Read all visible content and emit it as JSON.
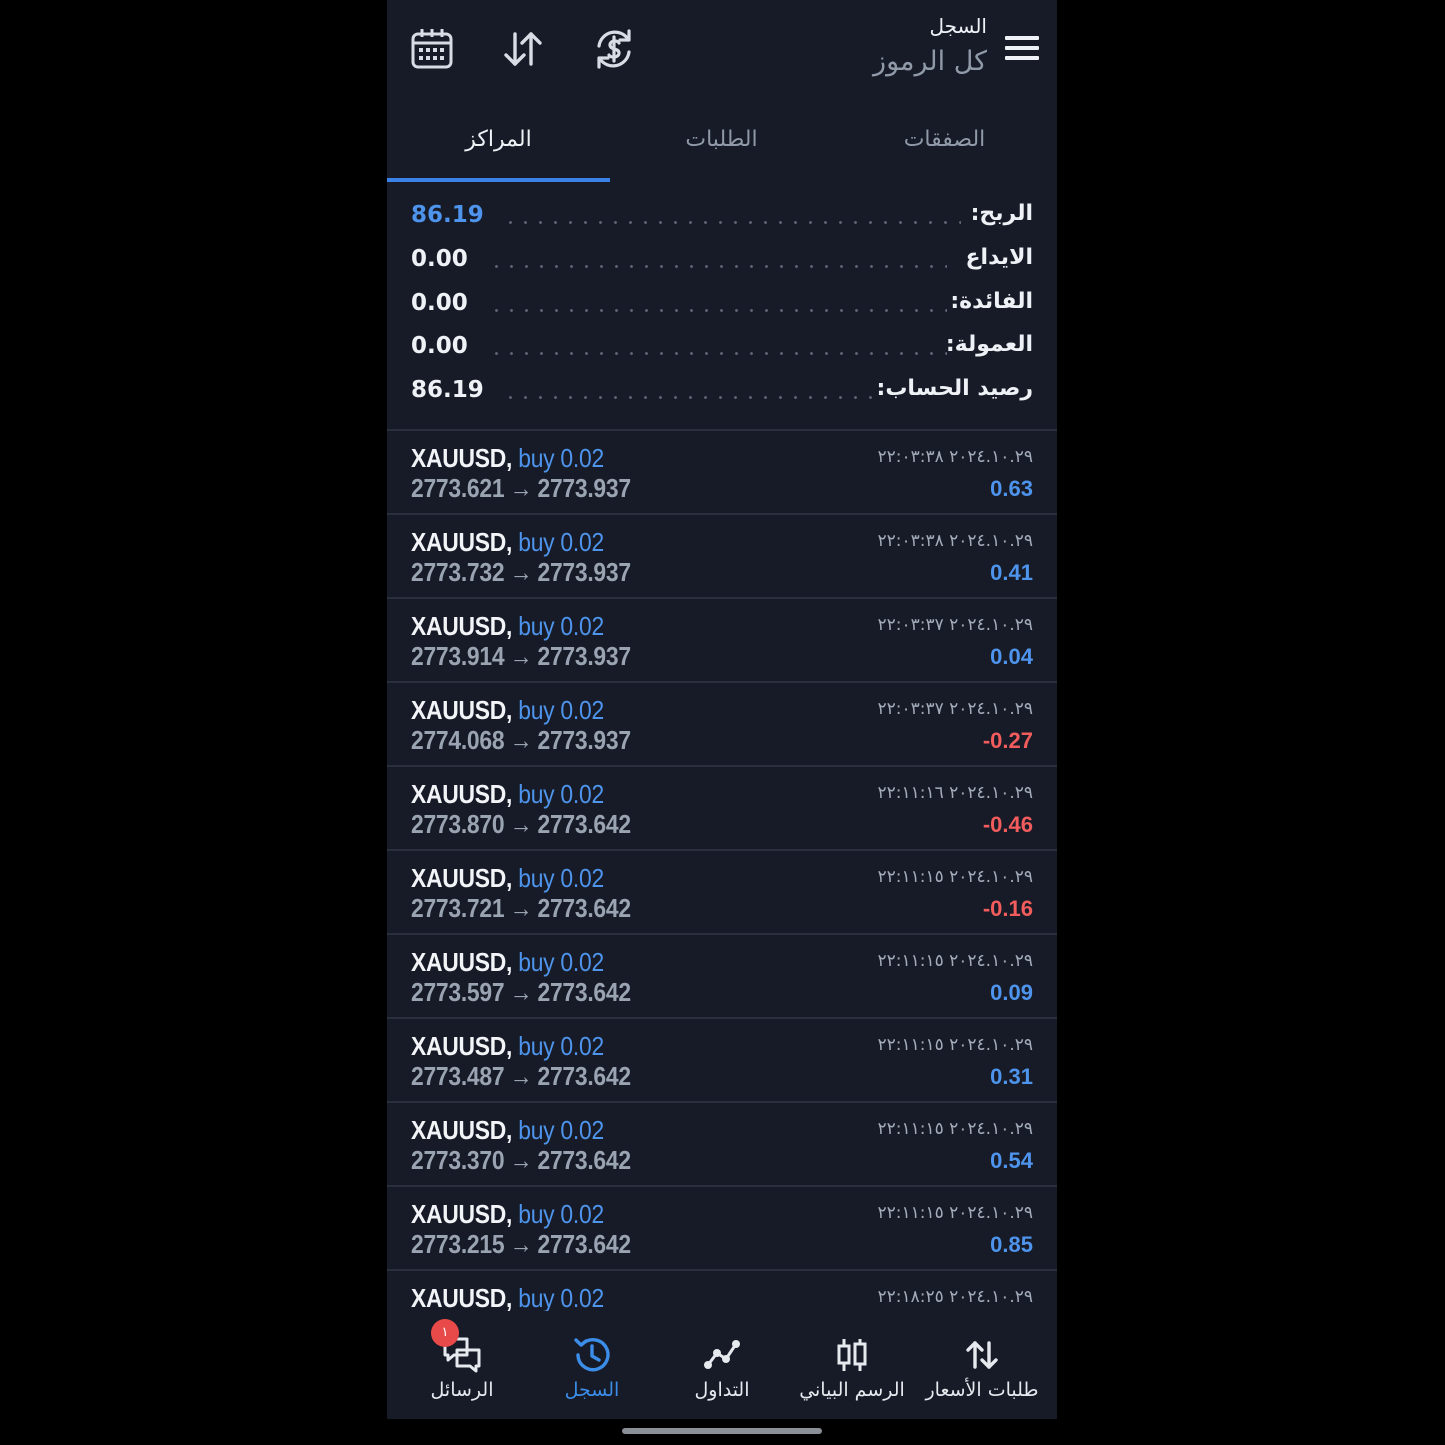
{
  "header": {
    "title": "السجل",
    "subtitle": "كل الرموز",
    "icons": [
      "calendar-icon",
      "sort-icon",
      "currency-refresh-icon",
      "menu-icon"
    ]
  },
  "tabs": [
    {
      "label": "المراكز",
      "active": true
    },
    {
      "label": "الطلبات",
      "active": false
    },
    {
      "label": "الصفقات",
      "active": false
    }
  ],
  "summary": {
    "profit": {
      "label": "الربح:",
      "value": "86.19"
    },
    "deposit": {
      "label": "الايداع",
      "value": "0.00"
    },
    "interest": {
      "label": "الفائدة:",
      "value": "0.00"
    },
    "commission": {
      "label": "العمولة:",
      "value": "0.00"
    },
    "balance": {
      "label": "رصيد الحساب:",
      "value": "86.19"
    }
  },
  "positions": [
    {
      "symbol": "XAUUSD,",
      "side": "buy 0.02",
      "open": "2773.621",
      "close": "2773.937",
      "time": "٢٠٢٤.١٠.٢٩ ٢٢:٠٣:٣٨",
      "profit": "0.63",
      "profit_sign": "pos"
    },
    {
      "symbol": "XAUUSD,",
      "side": "buy 0.02",
      "open": "2773.732",
      "close": "2773.937",
      "time": "٢٠٢٤.١٠.٢٩ ٢٢:٠٣:٣٨",
      "profit": "0.41",
      "profit_sign": "pos"
    },
    {
      "symbol": "XAUUSD,",
      "side": "buy 0.02",
      "open": "2773.914",
      "close": "2773.937",
      "time": "٢٠٢٤.١٠.٢٩ ٢٢:٠٣:٣٧",
      "profit": "0.04",
      "profit_sign": "pos"
    },
    {
      "symbol": "XAUUSD,",
      "side": "buy 0.02",
      "open": "2774.068",
      "close": "2773.937",
      "time": "٢٠٢٤.١٠.٢٩ ٢٢:٠٣:٣٧",
      "profit": "-0.27",
      "profit_sign": "neg"
    },
    {
      "symbol": "XAUUSD,",
      "side": "buy 0.02",
      "open": "2773.870",
      "close": "2773.642",
      "time": "٢٠٢٤.١٠.٢٩ ٢٢:١١:١٦",
      "profit": "-0.46",
      "profit_sign": "neg"
    },
    {
      "symbol": "XAUUSD,",
      "side": "buy 0.02",
      "open": "2773.721",
      "close": "2773.642",
      "time": "٢٠٢٤.١٠.٢٩ ٢٢:١١:١٥",
      "profit": "-0.16",
      "profit_sign": "neg"
    },
    {
      "symbol": "XAUUSD,",
      "side": "buy 0.02",
      "open": "2773.597",
      "close": "2773.642",
      "time": "٢٠٢٤.١٠.٢٩ ٢٢:١١:١٥",
      "profit": "0.09",
      "profit_sign": "pos"
    },
    {
      "symbol": "XAUUSD,",
      "side": "buy 0.02",
      "open": "2773.487",
      "close": "2773.642",
      "time": "٢٠٢٤.١٠.٢٩ ٢٢:١١:١٥",
      "profit": "0.31",
      "profit_sign": "pos"
    },
    {
      "symbol": "XAUUSD,",
      "side": "buy 0.02",
      "open": "2773.370",
      "close": "2773.642",
      "time": "٢٠٢٤.١٠.٢٩ ٢٢:١١:١٥",
      "profit": "0.54",
      "profit_sign": "pos"
    },
    {
      "symbol": "XAUUSD,",
      "side": "buy 0.02",
      "open": "2773.215",
      "close": "2773.642",
      "time": "٢٠٢٤.١٠.٢٩ ٢٢:١١:١٥",
      "profit": "0.85",
      "profit_sign": "pos"
    },
    {
      "symbol": "XAUUSD,",
      "side": "buy 0.02",
      "open": "",
      "close": "",
      "time": "٢٠٢٤.١٠.٢٩ ٢٢:١٨:٢٥",
      "profit": "",
      "profit_sign": "pos"
    }
  ],
  "price_arrow": "→",
  "bottom_nav": {
    "messages": {
      "label": "الرسائل",
      "badge": "١"
    },
    "history": {
      "label": "السجل"
    },
    "trade": {
      "label": "التداول"
    },
    "chart": {
      "label": "الرسم البياني"
    },
    "quotes": {
      "label": "طلبات الأسعار"
    }
  },
  "colors": {
    "accent": "#3b8de8",
    "profit_positive": "#4e94ec",
    "profit_negative": "#f25c5c",
    "background": "#161b27"
  }
}
